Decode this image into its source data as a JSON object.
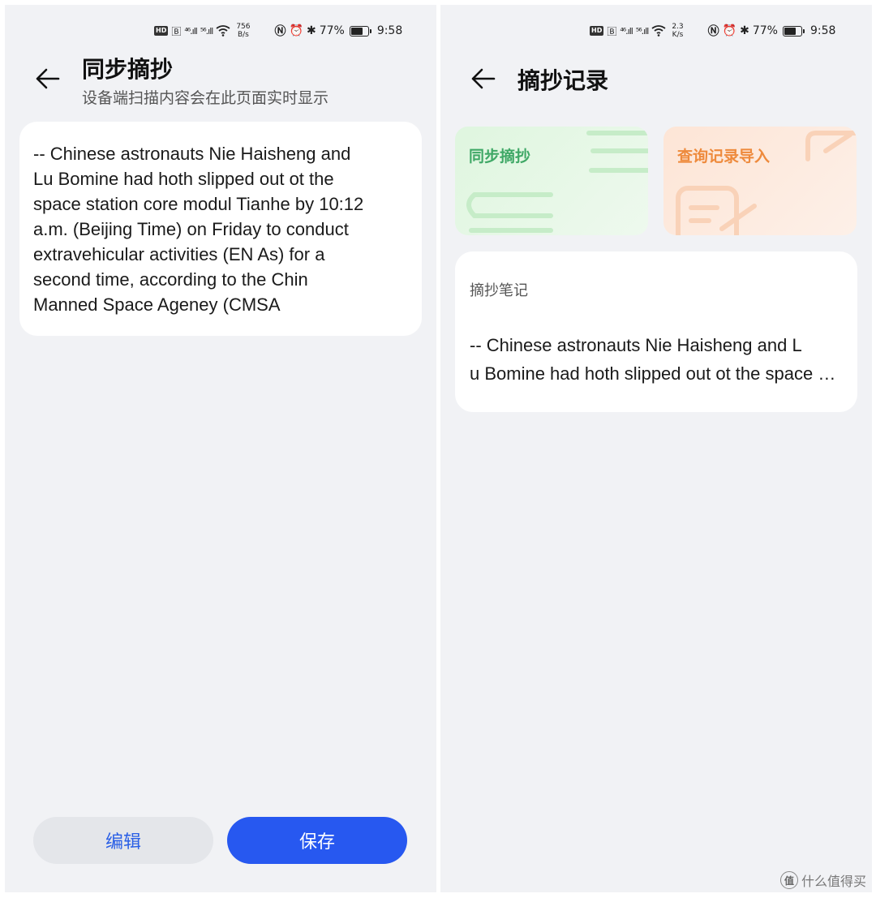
{
  "left": {
    "status": {
      "hd": "HD",
      "signal1": "⁴⁶.ıll",
      "signal2": "⁵⁶.ıll",
      "wifi": "⁶",
      "speed_value": "756",
      "speed_unit": "B/s",
      "battery": "77%",
      "battery_level": 0.77,
      "time": "9:58"
    },
    "header": {
      "title": "同步摘抄",
      "subtitle": "设备端扫描内容会在此页面实时显示"
    },
    "content_lines": [
      "-- Chinese astronauts Nie Haisheng and",
      "Lu Bomine had hoth slipped out ot the",
      "space station core modul Tianhe by 10:12",
      "a.m. (Beijing Time) on Friday to conduct",
      "extravehicular activities (EN As) for a",
      "second time, according to the Chin",
      "Manned Space Ageney (CMSA"
    ],
    "buttons": {
      "edit": "编辑",
      "save": "保存"
    }
  },
  "right": {
    "status": {
      "hd": "HD",
      "signal1": "⁴⁶.ıll",
      "signal2": "⁵⁶.ıll",
      "wifi": "⁶",
      "speed_value": "2.3",
      "speed_unit": "K/s",
      "battery": "77%",
      "battery_level": 0.77,
      "time": "9:58"
    },
    "header": {
      "title": "摘抄记录"
    },
    "tiles": {
      "sync": "同步摘抄",
      "import": "查询记录导入"
    },
    "note": {
      "label": "摘抄笔记",
      "line1": "-- Chinese astronauts Nie Haisheng and L",
      "line2": "u Bomine had hoth slipped out ot the space station core modul"
    }
  },
  "watermark": {
    "badge": "值",
    "text": "什么值得买"
  },
  "colors": {
    "primary_blue": "#2758f0",
    "green_tile_text": "#3fa866",
    "orange_tile_text": "#ee8a3c"
  }
}
